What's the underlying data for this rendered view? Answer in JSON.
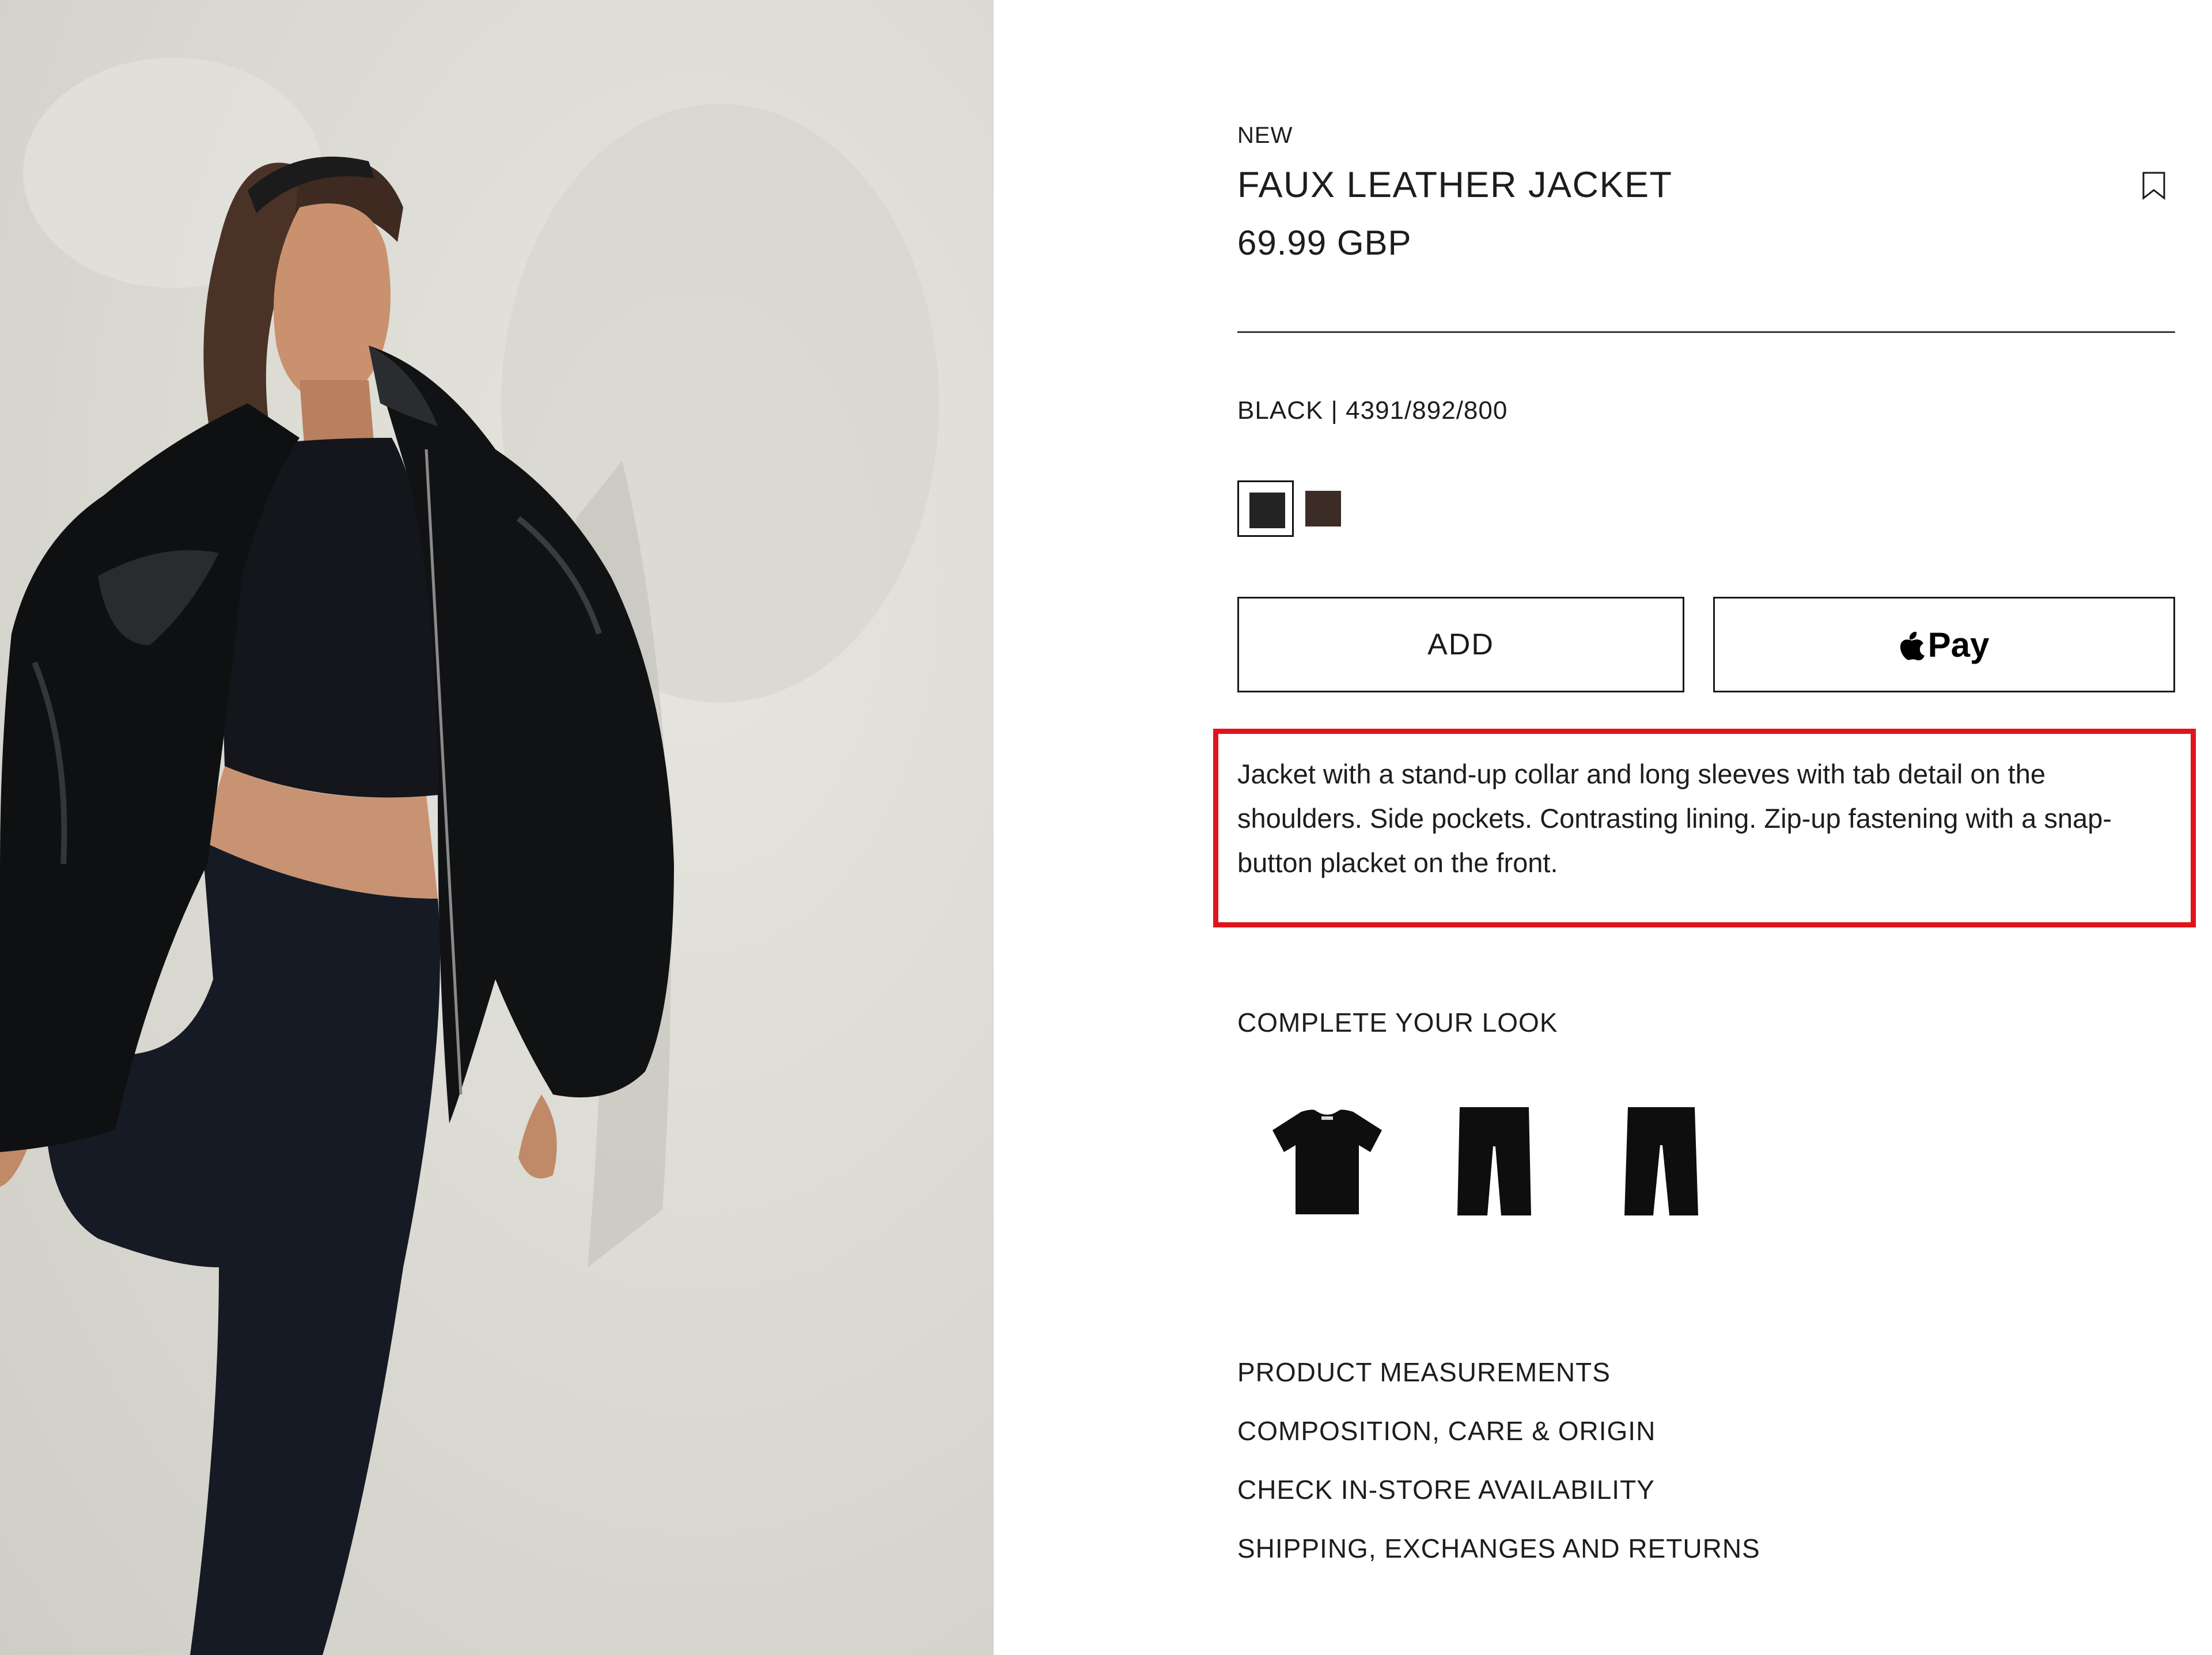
{
  "photo": {
    "alt_semantic": "model-photo",
    "background": "#dcdbd4"
  },
  "product": {
    "badge": "NEW",
    "title": "FAUX LEATHER JACKET",
    "price": "69.99 GBP",
    "color_ref": "BLACK | 4391/892/800",
    "bookmark_icon": "bookmark-icon",
    "swatches": [
      {
        "name": "black",
        "color": "#232323",
        "selected": true
      },
      {
        "name": "brown",
        "color": "#3b2d25",
        "selected": false
      }
    ],
    "add_label": "ADD",
    "pay_label": "Pay",
    "pay_icon": "apple-icon",
    "description": "Jacket with a stand-up collar and long sleeves with tab detail on the shoulders. Side pockets. Contrasting lining. Zip-up fastening with a snap-button placket on the front.",
    "highlight_color": "#e0141c"
  },
  "complete_look": {
    "title": "COMPLETE YOUR LOOK",
    "items": [
      {
        "icon": "t-shirt-icon"
      },
      {
        "icon": "trousers-icon"
      },
      {
        "icon": "trousers-icon"
      }
    ]
  },
  "info_links": [
    "PRODUCT MEASUREMENTS",
    "COMPOSITION, CARE & ORIGIN",
    "CHECK IN-STORE AVAILABILITY",
    "SHIPPING, EXCHANGES AND RETURNS"
  ]
}
